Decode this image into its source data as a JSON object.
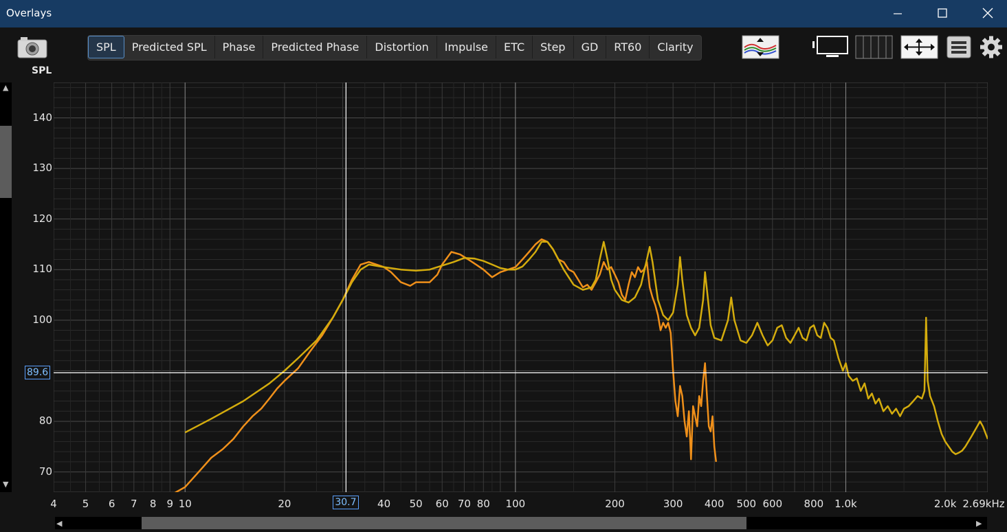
{
  "window": {
    "title": "Overlays"
  },
  "tabs": [
    {
      "label": "SPL",
      "active": true
    },
    {
      "label": "Predicted SPL",
      "active": false
    },
    {
      "label": "Phase",
      "active": false
    },
    {
      "label": "Predicted Phase",
      "active": false
    },
    {
      "label": "Distortion",
      "active": false
    },
    {
      "label": "Impulse",
      "active": false
    },
    {
      "label": "ETC",
      "active": false
    },
    {
      "label": "Step",
      "active": false
    },
    {
      "label": "GD",
      "active": false
    },
    {
      "label": "RT60",
      "active": false
    },
    {
      "label": "Clarity",
      "active": false
    }
  ],
  "panel": {
    "label": "SPL"
  },
  "cursor": {
    "y_value": "89.6",
    "x_value": "30.7"
  },
  "icons": {
    "snapshot": "camera-icon",
    "controls": "trace-arrange-icon",
    "monitor": "monitor-icon",
    "columns": "columns-icon",
    "fit": "fit-arrows-icon",
    "legend": "legend-icon",
    "settings": "gear-icon"
  },
  "colors": {
    "series_orange": "#f0901a",
    "series_yellow": "#d4ac0d",
    "grid": "#3a3a3a",
    "cursor": "#ffffff",
    "active_tab_border": "#5a90c8"
  },
  "chart_data": {
    "type": "line",
    "x_scale": "log",
    "xlim": [
      4,
      2690
    ],
    "ylim": [
      66,
      147
    ],
    "y_ticks": [
      {
        "v": 140,
        "label": "140"
      },
      {
        "v": 130,
        "label": "130"
      },
      {
        "v": 120,
        "label": "120"
      },
      {
        "v": 110,
        "label": "110"
      },
      {
        "v": 100,
        "label": "100"
      },
      {
        "v": 80,
        "label": "80"
      },
      {
        "v": 70,
        "label": "70"
      }
    ],
    "x_ticks": [
      {
        "v": 4,
        "label": "4"
      },
      {
        "v": 5,
        "label": "5"
      },
      {
        "v": 6,
        "label": "6"
      },
      {
        "v": 7,
        "label": "7"
      },
      {
        "v": 8,
        "label": "8"
      },
      {
        "v": 9,
        "label": "9"
      },
      {
        "v": 10,
        "label": "10"
      },
      {
        "v": 20,
        "label": "20"
      },
      {
        "v": 40,
        "label": "40"
      },
      {
        "v": 50,
        "label": "50"
      },
      {
        "v": 60,
        "label": "60"
      },
      {
        "v": 70,
        "label": "70"
      },
      {
        "v": 80,
        "label": "80"
      },
      {
        "v": 100,
        "label": "100"
      },
      {
        "v": 200,
        "label": "200"
      },
      {
        "v": 300,
        "label": "300"
      },
      {
        "v": 400,
        "label": "400"
      },
      {
        "v": 500,
        "label": "500"
      },
      {
        "v": 600,
        "label": "600"
      },
      {
        "v": 800,
        "label": "800"
      },
      {
        "v": 1000,
        "label": "1.0k"
      },
      {
        "v": 2000,
        "label": "2.0k"
      },
      {
        "v": 2690,
        "label": "2.69kHz"
      }
    ],
    "cursor_x": 30.7,
    "cursor_y": 89.6,
    "series": [
      {
        "color": "#f0901a",
        "points": [
          [
            9.1,
            65.5
          ],
          [
            10,
            67
          ],
          [
            11,
            70
          ],
          [
            12,
            72.8
          ],
          [
            13,
            74.5
          ],
          [
            14,
            76.5
          ],
          [
            15,
            79
          ],
          [
            16,
            81
          ],
          [
            17,
            82.5
          ],
          [
            18,
            84.5
          ],
          [
            19,
            86.5
          ],
          [
            20,
            88
          ],
          [
            22,
            90.5
          ],
          [
            24,
            94
          ],
          [
            26,
            97
          ],
          [
            28,
            100.5
          ],
          [
            30,
            104
          ],
          [
            32,
            108
          ],
          [
            34,
            111
          ],
          [
            36,
            111.5
          ],
          [
            38,
            111
          ],
          [
            40,
            110.5
          ],
          [
            42,
            109.5
          ],
          [
            45,
            107.5
          ],
          [
            48,
            106.8
          ],
          [
            50,
            107.5
          ],
          [
            55,
            107.5
          ],
          [
            58,
            109
          ],
          [
            60,
            111
          ],
          [
            64,
            113.5
          ],
          [
            68,
            113
          ],
          [
            72,
            112
          ],
          [
            76,
            111
          ],
          [
            80,
            110
          ],
          [
            85,
            108.5
          ],
          [
            90,
            109.5
          ],
          [
            95,
            110
          ],
          [
            100,
            110.5
          ],
          [
            105,
            112
          ],
          [
            110,
            113.5
          ],
          [
            115,
            115
          ],
          [
            120,
            116
          ],
          [
            125,
            115.5
          ],
          [
            130,
            114
          ],
          [
            135,
            112
          ],
          [
            140,
            111.5
          ],
          [
            145,
            110
          ],
          [
            150,
            109.5
          ],
          [
            155,
            108
          ],
          [
            160,
            106.5
          ],
          [
            165,
            107
          ],
          [
            170,
            106
          ],
          [
            175,
            107.5
          ],
          [
            180,
            109
          ],
          [
            185,
            111.5
          ],
          [
            190,
            110
          ],
          [
            195,
            110.5
          ],
          [
            200,
            109
          ],
          [
            205,
            107.5
          ],
          [
            210,
            105
          ],
          [
            215,
            104
          ],
          [
            220,
            107
          ],
          [
            225,
            109.5
          ],
          [
            230,
            108.5
          ],
          [
            235,
            110.5
          ],
          [
            240,
            109.5
          ],
          [
            245,
            110
          ],
          [
            250,
            111.5
          ],
          [
            255,
            106.5
          ],
          [
            260,
            104.5
          ],
          [
            265,
            103
          ],
          [
            270,
            101
          ],
          [
            275,
            98
          ],
          [
            280,
            99.5
          ],
          [
            285,
            98.5
          ],
          [
            290,
            99.5
          ],
          [
            295,
            97.5
          ],
          [
            300,
            90
          ],
          [
            305,
            84
          ],
          [
            310,
            81
          ],
          [
            315,
            87
          ],
          [
            320,
            85
          ],
          [
            325,
            80
          ],
          [
            330,
            77
          ],
          [
            335,
            82
          ],
          [
            340,
            72.5
          ],
          [
            345,
            83
          ],
          [
            350,
            81
          ],
          [
            355,
            79
          ],
          [
            360,
            85
          ],
          [
            365,
            83
          ],
          [
            370,
            88
          ],
          [
            375,
            91.5
          ],
          [
            380,
            85
          ],
          [
            385,
            79
          ],
          [
            390,
            78
          ],
          [
            395,
            81
          ],
          [
            400,
            75
          ],
          [
            405,
            72
          ]
        ]
      },
      {
        "color": "#d4ac0d",
        "points": [
          [
            10,
            77.8
          ],
          [
            12,
            80.5
          ],
          [
            15,
            84
          ],
          [
            18,
            87.5
          ],
          [
            20,
            90
          ],
          [
            22,
            92.5
          ],
          [
            25,
            96
          ],
          [
            28,
            100.5
          ],
          [
            30,
            104
          ],
          [
            32,
            107.5
          ],
          [
            34,
            110
          ],
          [
            36,
            111
          ],
          [
            40,
            110.5
          ],
          [
            45,
            110
          ],
          [
            50,
            109.8
          ],
          [
            55,
            110
          ],
          [
            60,
            110.8
          ],
          [
            65,
            111.5
          ],
          [
            70,
            112.3
          ],
          [
            75,
            112.2
          ],
          [
            80,
            111.7
          ],
          [
            85,
            111
          ],
          [
            90,
            110.3
          ],
          [
            95,
            110
          ],
          [
            100,
            110
          ],
          [
            105,
            110.6
          ],
          [
            110,
            112
          ],
          [
            115,
            113.5
          ],
          [
            120,
            115.5
          ],
          [
            125,
            115.5
          ],
          [
            130,
            114
          ],
          [
            140,
            110
          ],
          [
            150,
            107
          ],
          [
            160,
            106
          ],
          [
            170,
            106.5
          ],
          [
            175,
            108
          ],
          [
            180,
            112
          ],
          [
            185,
            115.5
          ],
          [
            190,
            112
          ],
          [
            195,
            108
          ],
          [
            200,
            106
          ],
          [
            210,
            104
          ],
          [
            220,
            103.5
          ],
          [
            230,
            104.5
          ],
          [
            240,
            107
          ],
          [
            250,
            112
          ],
          [
            255,
            114.5
          ],
          [
            260,
            111.5
          ],
          [
            270,
            104
          ],
          [
            280,
            101
          ],
          [
            290,
            100
          ],
          [
            300,
            101.5
          ],
          [
            310,
            107
          ],
          [
            315,
            112.5
          ],
          [
            320,
            108
          ],
          [
            330,
            101
          ],
          [
            340,
            98.5
          ],
          [
            350,
            97
          ],
          [
            360,
            98.5
          ],
          [
            370,
            104
          ],
          [
            375,
            109.5
          ],
          [
            380,
            106
          ],
          [
            390,
            99
          ],
          [
            400,
            96.5
          ],
          [
            420,
            96
          ],
          [
            440,
            100
          ],
          [
            450,
            104.5
          ],
          [
            460,
            100
          ],
          [
            480,
            96
          ],
          [
            500,
            95.5
          ],
          [
            520,
            97
          ],
          [
            540,
            99.5
          ],
          [
            560,
            97
          ],
          [
            580,
            95
          ],
          [
            600,
            96
          ],
          [
            620,
            98.5
          ],
          [
            640,
            99
          ],
          [
            660,
            96.5
          ],
          [
            680,
            95.5
          ],
          [
            700,
            97
          ],
          [
            720,
            98.5
          ],
          [
            740,
            96.5
          ],
          [
            760,
            96
          ],
          [
            780,
            98.5
          ],
          [
            800,
            99
          ],
          [
            820,
            97
          ],
          [
            840,
            96.5
          ],
          [
            860,
            99.5
          ],
          [
            880,
            98.5
          ],
          [
            900,
            96.5
          ],
          [
            920,
            96
          ],
          [
            950,
            92.5
          ],
          [
            980,
            90
          ],
          [
            1000,
            91.5
          ],
          [
            1020,
            89
          ],
          [
            1050,
            88
          ],
          [
            1080,
            88.5
          ],
          [
            1110,
            86
          ],
          [
            1140,
            87.5
          ],
          [
            1170,
            84.5
          ],
          [
            1200,
            85.5
          ],
          [
            1230,
            83.5
          ],
          [
            1260,
            84.5
          ],
          [
            1300,
            82
          ],
          [
            1340,
            83
          ],
          [
            1380,
            81.5
          ],
          [
            1420,
            82.5
          ],
          [
            1460,
            81
          ],
          [
            1500,
            82.5
          ],
          [
            1550,
            83
          ],
          [
            1600,
            84
          ],
          [
            1650,
            85
          ],
          [
            1700,
            84.5
          ],
          [
            1730,
            86
          ],
          [
            1750,
            100.5
          ],
          [
            1770,
            88
          ],
          [
            1800,
            85
          ],
          [
            1850,
            83
          ],
          [
            1900,
            80
          ],
          [
            1950,
            77.5
          ],
          [
            2000,
            76
          ],
          [
            2050,
            75
          ],
          [
            2100,
            74
          ],
          [
            2150,
            73.5
          ],
          [
            2200,
            73.8
          ],
          [
            2250,
            74.2
          ],
          [
            2300,
            75
          ],
          [
            2400,
            77
          ],
          [
            2500,
            79
          ],
          [
            2550,
            80
          ],
          [
            2600,
            79
          ],
          [
            2690,
            76.5
          ]
        ]
      }
    ]
  }
}
